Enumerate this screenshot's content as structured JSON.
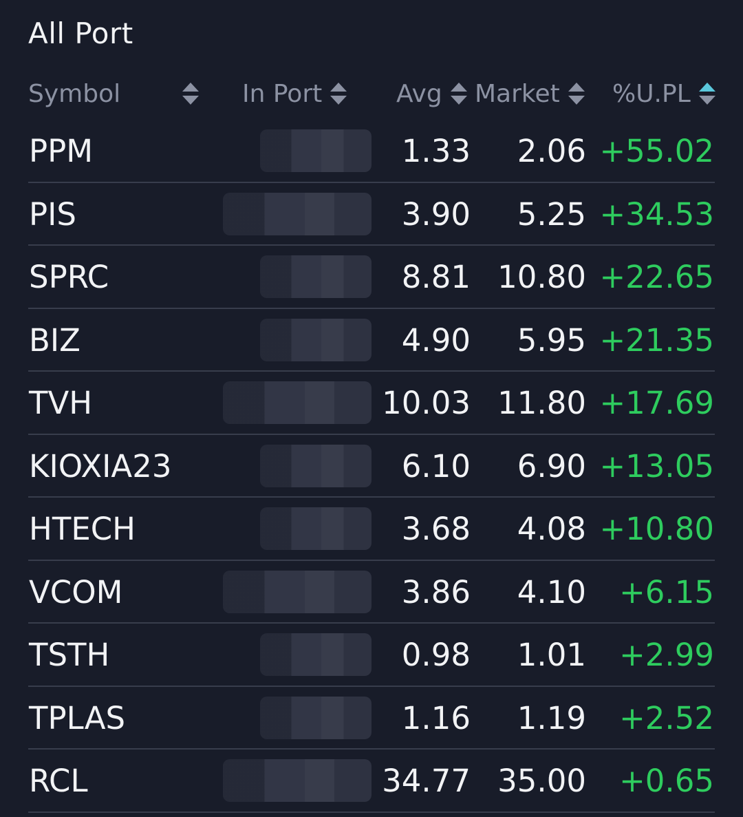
{
  "header": {
    "title": "All Port"
  },
  "columns": {
    "symbol": "Symbol",
    "in_port": "In Port",
    "avg": "Avg",
    "market": "Market",
    "upl": "%U.PL"
  },
  "rows": [
    {
      "symbol": "PPM",
      "avg": "1.33",
      "market": "2.06",
      "upl": "+55.02"
    },
    {
      "symbol": "PIS",
      "avg": "3.90",
      "market": "5.25",
      "upl": "+34.53"
    },
    {
      "symbol": "SPRC",
      "avg": "8.81",
      "market": "10.80",
      "upl": "+22.65"
    },
    {
      "symbol": "BIZ",
      "avg": "4.90",
      "market": "5.95",
      "upl": "+21.35"
    },
    {
      "symbol": "TVH",
      "avg": "10.03",
      "market": "11.80",
      "upl": "+17.69"
    },
    {
      "symbol": "KIOXIA23",
      "avg": "6.10",
      "market": "6.90",
      "upl": "+13.05"
    },
    {
      "symbol": "HTECH",
      "avg": "3.68",
      "market": "4.08",
      "upl": "+10.80"
    },
    {
      "symbol": "VCOM",
      "avg": "3.86",
      "market": "4.10",
      "upl": "+6.15"
    },
    {
      "symbol": "TSTH",
      "avg": "0.98",
      "market": "1.01",
      "upl": "+2.99"
    },
    {
      "symbol": "TPLAS",
      "avg": "1.16",
      "market": "1.19",
      "upl": "+2.52"
    },
    {
      "symbol": "RCL",
      "avg": "34.77",
      "market": "35.00",
      "upl": "+0.65"
    }
  ],
  "colors": {
    "background": "#181c29",
    "text": "#f2f3f5",
    "header_text": "#8c92a3",
    "gain": "#2ecc5e",
    "active_sort": "#5bc8dc",
    "divider": "#383d4c"
  }
}
